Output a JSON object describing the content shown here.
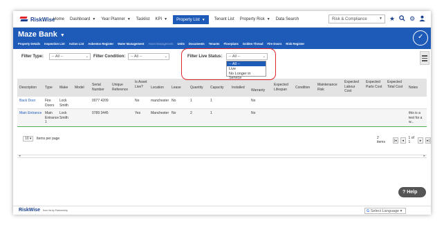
{
  "brand": {
    "name": "RiskWise",
    "footer_name": "RiskWise",
    "footer_tagline": "from rfa by Partnership"
  },
  "nav": [
    {
      "label": "Home",
      "caret": false
    },
    {
      "label": "Dashboard",
      "caret": true
    },
    {
      "label": "Year Planner",
      "caret": true
    },
    {
      "label": "Tasklist",
      "caret": false
    },
    {
      "label": "KPI",
      "caret": true
    },
    {
      "label": "Property List",
      "caret": true,
      "active": true
    },
    {
      "label": "Tenant List",
      "caret": false
    },
    {
      "label": "Property Risk",
      "caret": true
    },
    {
      "label": "Data Search",
      "caret": false
    }
  ],
  "risk_select": {
    "value": "Risk & Compliance"
  },
  "site": {
    "title": "Maze Bank"
  },
  "subnav": [
    {
      "label": "Property Details"
    },
    {
      "label": "Inspection List"
    },
    {
      "label": "Action List"
    },
    {
      "label": "Asbestos Register"
    },
    {
      "label": "Water Management"
    },
    {
      "label": "Asset Management",
      "dim": true
    },
    {
      "label": "Units"
    },
    {
      "label": "Documents"
    },
    {
      "label": "Tenants"
    },
    {
      "label": "Floorplans"
    },
    {
      "label": "Golden Thread"
    },
    {
      "label": "Fire Doors"
    },
    {
      "label": "Risk Register"
    }
  ],
  "filters": {
    "type_label": "Filter Type:",
    "type_value": "-- All --",
    "condition_label": "Filter Condition:",
    "condition_value": "-- All --",
    "status_label": "Filter Live Status:",
    "status_value": "-- All --",
    "status_options": [
      "-- All --",
      "Live",
      "No Longer in Service"
    ]
  },
  "columns": [
    "Description",
    "Type",
    "Make",
    "Model",
    "Serial Number",
    "Unique Reference",
    "Is Asset Live?",
    "Location",
    "Lease",
    "Quantity",
    "Capacity",
    "Installed",
    "Warranty",
    "Expected Lifespan",
    "Condition",
    "Maintenance Risk",
    "Expected Labour Cost",
    "Expected Parts Cost",
    "Expected Total Cost",
    "Notes"
  ],
  "rows": [
    {
      "description": "Back Door",
      "type": "Fire Doors",
      "make": "Lock Smith",
      "serial": "0077 4209",
      "live": "No",
      "location": "manchester",
      "lease": "No",
      "quantity": "1",
      "capacity": "1",
      "warranty": "No",
      "notes": ""
    },
    {
      "description": "Main Entrance",
      "type": "Main Entrance 1",
      "make": "Lock Smith",
      "serial": "0789 3445",
      "live": "Yes",
      "location": "Manchester",
      "lease": "No",
      "quantity": "2",
      "capacity": "1",
      "warranty": "No",
      "notes": "this is a test for a w..."
    }
  ],
  "pager": {
    "page_size": "10",
    "items_per_page": "Items per page",
    "items": "2 items",
    "page_info": "1 of 1"
  },
  "footer": {
    "language": "Select Language",
    "help": "Help"
  }
}
